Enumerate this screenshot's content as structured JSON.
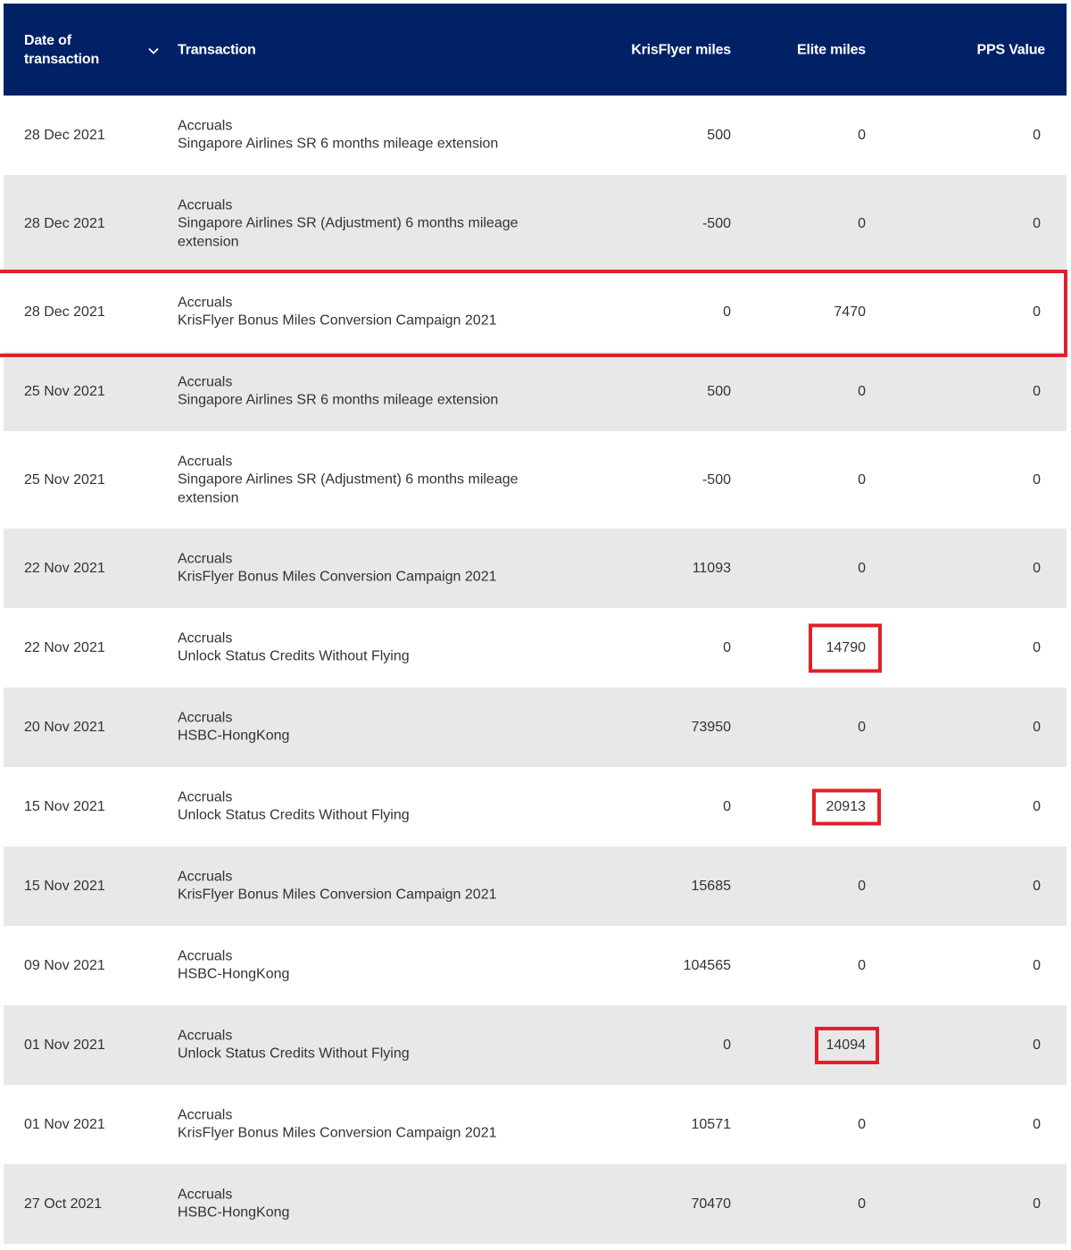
{
  "header": {
    "date_label": "Date of transaction",
    "transaction_label": "Transaction",
    "krisflyer_label": "KrisFlyer miles",
    "elite_label": "Elite miles",
    "pps_label": "PPS Value",
    "sort_icon": "chevron-down-icon"
  },
  "colors": {
    "header_bg": "#002166",
    "alt_row": "#e8e8e8",
    "highlight": "#e0202a"
  },
  "rows": [
    {
      "date": "28 Dec 2021",
      "type": "Accruals",
      "desc": "Singapore Airlines SR 6 months mileage extension",
      "kf": "500",
      "elite": "0",
      "pps": "0"
    },
    {
      "date": "28 Dec 2021",
      "type": "Accruals",
      "desc": "Singapore Airlines SR (Adjustment) 6 months mileage extension",
      "kf": "-500",
      "elite": "0",
      "pps": "0"
    },
    {
      "date": "28 Dec 2021",
      "type": "Accruals",
      "desc": "KrisFlyer Bonus Miles Conversion Campaign 2021",
      "kf": "0",
      "elite": "7470",
      "pps": "0"
    },
    {
      "date": "25 Nov 2021",
      "type": "Accruals",
      "desc": "Singapore Airlines SR 6 months mileage extension",
      "kf": "500",
      "elite": "0",
      "pps": "0"
    },
    {
      "date": "25 Nov 2021",
      "type": "Accruals",
      "desc": "Singapore Airlines SR (Adjustment) 6 months mileage extension",
      "kf": "-500",
      "elite": "0",
      "pps": "0"
    },
    {
      "date": "22 Nov 2021",
      "type": "Accruals",
      "desc": "KrisFlyer Bonus Miles Conversion Campaign 2021",
      "kf": "11093",
      "elite": "0",
      "pps": "0"
    },
    {
      "date": "22 Nov 2021",
      "type": "Accruals",
      "desc": "Unlock Status Credits Without Flying",
      "kf": "0",
      "elite": "14790",
      "pps": "0"
    },
    {
      "date": "20 Nov 2021",
      "type": "Accruals",
      "desc": "HSBC-HongKong",
      "kf": "73950",
      "elite": "0",
      "pps": "0"
    },
    {
      "date": "15 Nov 2021",
      "type": "Accruals",
      "desc": "Unlock Status Credits Without Flying",
      "kf": "0",
      "elite": "20913",
      "pps": "0"
    },
    {
      "date": "15 Nov 2021",
      "type": "Accruals",
      "desc": "KrisFlyer Bonus Miles Conversion Campaign 2021",
      "kf": "15685",
      "elite": "0",
      "pps": "0"
    },
    {
      "date": "09 Nov 2021",
      "type": "Accruals",
      "desc": "HSBC-HongKong",
      "kf": "104565",
      "elite": "0",
      "pps": "0"
    },
    {
      "date": "01 Nov 2021",
      "type": "Accruals",
      "desc": "Unlock Status Credits Without Flying",
      "kf": "0",
      "elite": "14094",
      "pps": "0"
    },
    {
      "date": "01 Nov 2021",
      "type": "Accruals",
      "desc": "KrisFlyer Bonus Miles Conversion Campaign 2021",
      "kf": "10571",
      "elite": "0",
      "pps": "0"
    },
    {
      "date": "27 Oct 2021",
      "type": "Accruals",
      "desc": "HSBC-HongKong",
      "kf": "70470",
      "elite": "0",
      "pps": "0"
    }
  ]
}
